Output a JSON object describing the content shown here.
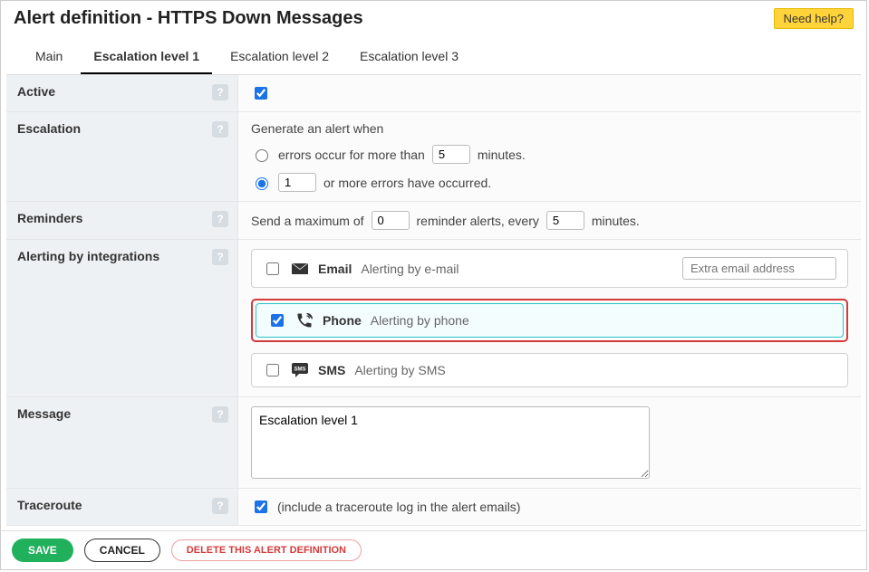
{
  "header": {
    "title": "Alert definition - HTTPS Down Messages",
    "help_label": "Need help?"
  },
  "tabs": [
    {
      "label": "Main"
    },
    {
      "label": "Escalation level 1"
    },
    {
      "label": "Escalation level 2"
    },
    {
      "label": "Escalation level 3"
    }
  ],
  "rows": {
    "active": {
      "label": "Active",
      "checked": true
    },
    "escalation": {
      "label": "Escalation",
      "intro": "Generate an alert when",
      "opt1_a": "errors occur for more than",
      "opt1_val": "5",
      "opt1_b": "minutes.",
      "opt2_val": "1",
      "opt2_b": "or more errors have occurred.",
      "selected": "opt2"
    },
    "reminders": {
      "label": "Reminders",
      "a": "Send a maximum of",
      "val1": "0",
      "b": "reminder alerts, every",
      "val2": "5",
      "c": "minutes."
    },
    "integrations": {
      "label": "Alerting by integrations",
      "email": {
        "name": "Email",
        "desc": "Alerting by e-mail",
        "extra_placeholder": "Extra email address",
        "checked": false
      },
      "phone": {
        "name": "Phone",
        "desc": "Alerting by phone",
        "checked": true
      },
      "sms": {
        "name": "SMS",
        "desc": "Alerting by SMS",
        "checked": false
      }
    },
    "message": {
      "label": "Message",
      "value": "Escalation level 1"
    },
    "traceroute": {
      "label": "Traceroute",
      "text": "(include a traceroute log in the alert emails)",
      "checked": true
    }
  },
  "footer": {
    "save": "SAVE",
    "cancel": "CANCEL",
    "delete": "DELETE THIS ALERT DEFINITION"
  }
}
